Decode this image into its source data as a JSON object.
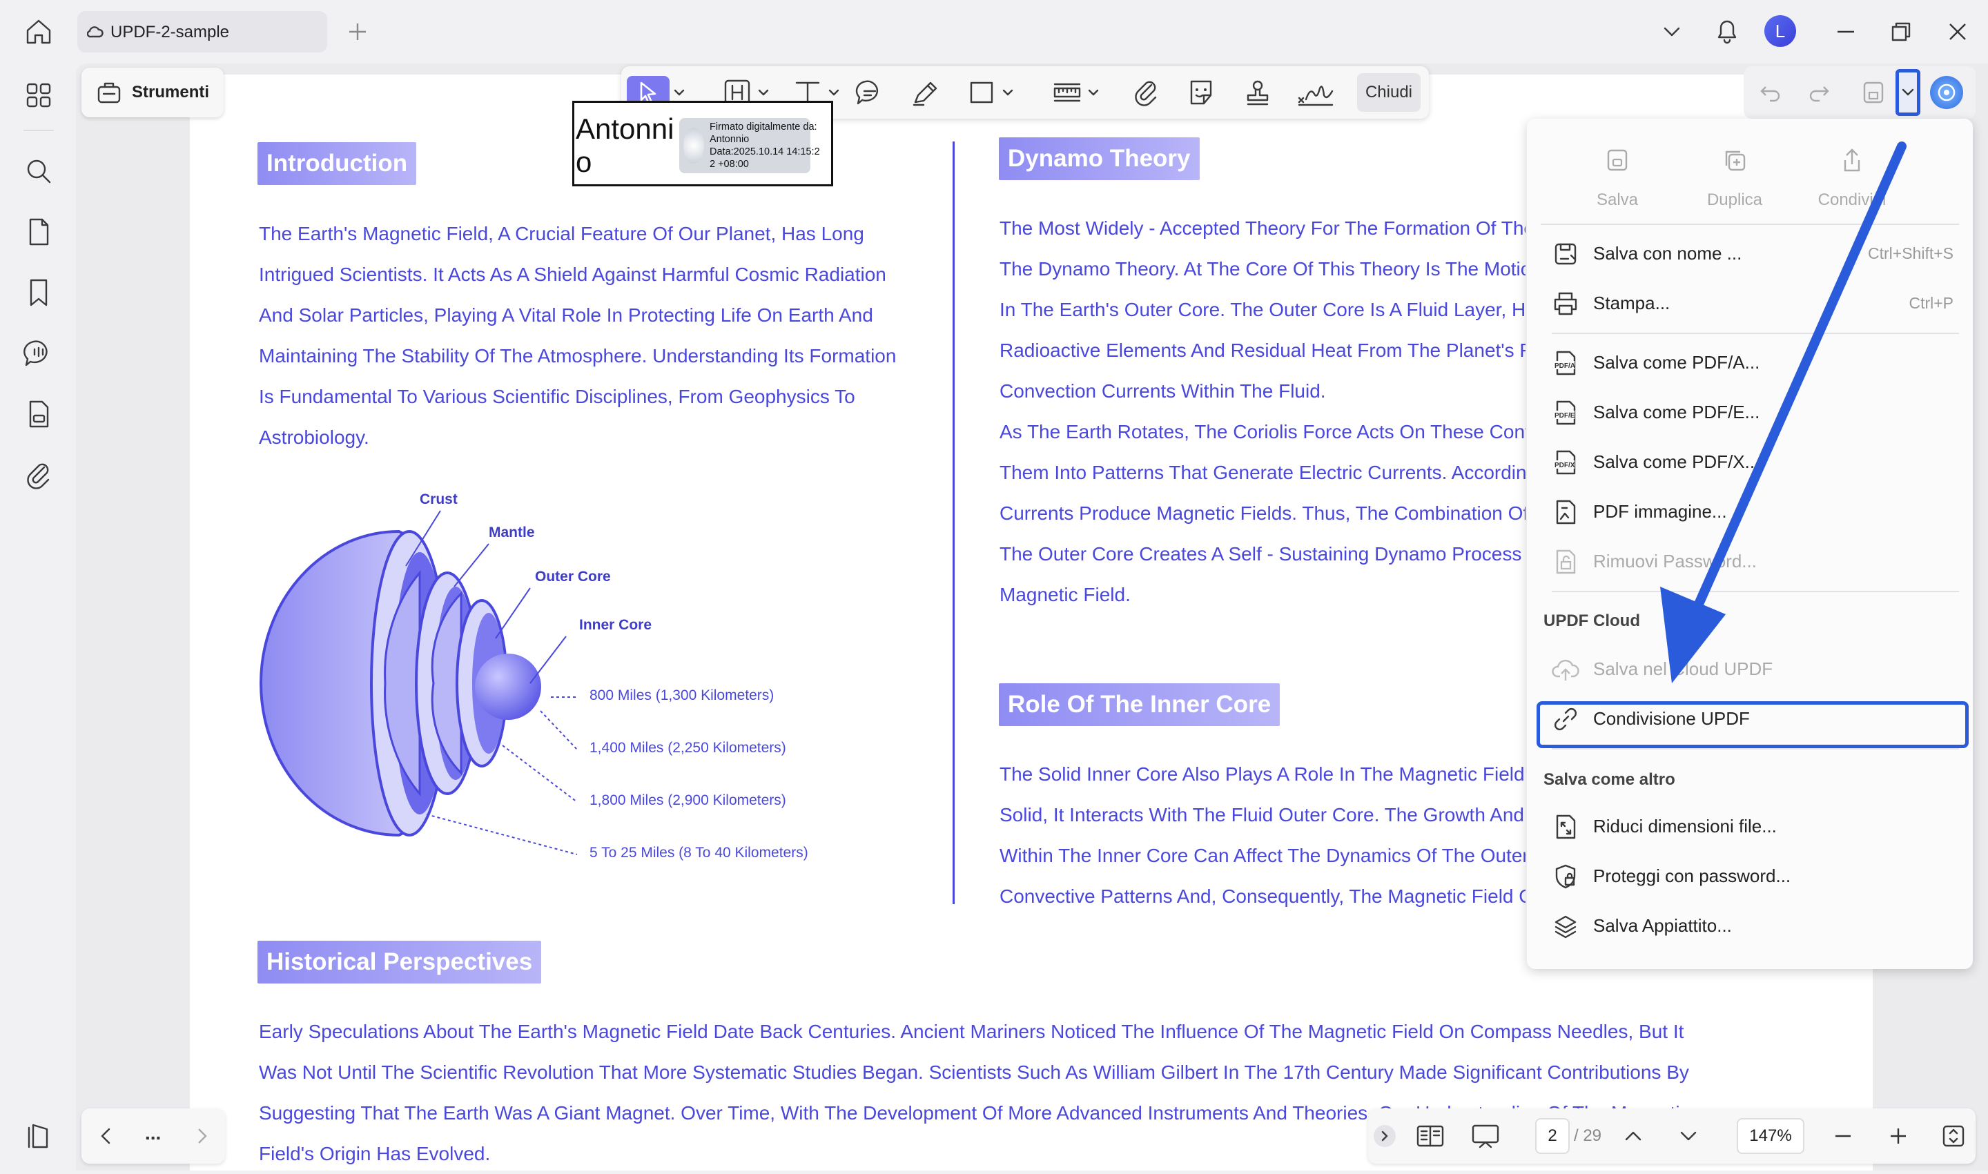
{
  "titlebar": {
    "tab_title": "UPDF-2-sample",
    "avatar_letter": "L",
    "accent": "#4a48dc"
  },
  "tools": {
    "strumenti_label": "Strumenti",
    "close_label": "Chiudi"
  },
  "signature": {
    "name": "Antonnio",
    "stamp_text": "Firmato digitalmente da:\nAntonnio\nData:2025.10.14 14:15:2\n2 +08:00"
  },
  "document": {
    "intro_heading": "Introduction",
    "intro_lines": [
      "The Earth's Magnetic Field, A Crucial Feature Of Our Planet, Has Long",
      "Intrigued Scientists. It Acts As A Shield Against Harmful Cosmic Radiation",
      "And Solar Particles, Playing A Vital Role In Protecting Life On Earth And",
      "Maintaining The Stability Of The Atmosphere. Understanding Its Formation",
      "Is Fundamental To Various Scientific Disciplines, From Geophysics To",
      "Astrobiology."
    ],
    "diagram_labels": {
      "crust": "Crust",
      "mantle": "Mantle",
      "outer_core": "Outer Core",
      "inner_core": "Inner Core",
      "d1": "800 Miles (1,300 Kilometers)",
      "d2": "1,400 Miles (2,250 Kilometers)",
      "d3": "1,800 Miles (2,900 Kilometers)",
      "d4": "5 To 25 Miles (8 To 40 Kilometers)"
    },
    "dynamo_heading": "Dynamo Theory",
    "dynamo_lines": [
      "The Most Widely - Accepted Theory For The Formation Of The",
      "The Dynamo Theory. At The Core Of This Theory Is The Motio",
      "In The Earth's Outer Core. The Outer Core Is A Fluid Layer, He",
      "Radioactive Elements And Residual Heat From The Planet's F",
      "Convection Currents Within The Fluid.",
      "As The Earth Rotates, The Coriolis Force Acts On These Conv",
      "Them Into Patterns That Generate Electric Currents. According",
      "Currents Produce Magnetic Fields. Thus, The Combination Of",
      "The Outer Core Creates A Self - Sustaining Dynamo Process T",
      "Magnetic Field."
    ],
    "inner_core_heading": "Role Of The Inner Core",
    "inner_core_lines": [
      "The Solid Inner Core Also Plays A Role In The Magnetic Field's",
      "Solid, It Interacts With The Fluid Outer Core. The Growth And C",
      "Within The Inner Core Can Affect The Dynamics Of The Outer",
      "Convective Patterns And, Consequently, The Magnetic Field G"
    ],
    "historical_heading": "Historical Perspectives",
    "historical_lines": [
      "Early Speculations About The Earth's Magnetic Field Date Back Centuries. Ancient Mariners Noticed The Influence Of The Magnetic Field On Compass Needles, But It",
      "Was Not Until The Scientific Revolution That More Systematic Studies Began. Scientists Such As William Gilbert In The 17th Century Made Significant Contributions By",
      "Suggesting That The Earth Was A Giant Magnet. Over Time, With The Development Of More Advanced Instruments And Theories, Our Understanding Of The Magnetic",
      "Field's Origin Has Evolved."
    ]
  },
  "menu": {
    "quick_actions": [
      "Salva",
      "Duplica",
      "Condividi"
    ],
    "items": [
      {
        "label": "Salva con nome ...",
        "shortcut": "Ctrl+Shift+S"
      },
      {
        "label": "Stampa...",
        "shortcut": "Ctrl+P"
      },
      {
        "label": "Salva come PDF/A..."
      },
      {
        "label": "Salva come PDF/E..."
      },
      {
        "label": "Salva come PDF/X..."
      },
      {
        "label": "PDF immagine..."
      },
      {
        "label": "Rimuovi Password..."
      }
    ],
    "cloud_section": "UPDF Cloud",
    "cloud_items": [
      {
        "label": "Salva nel Cloud UPDF"
      },
      {
        "label": "Condivisione UPDF"
      }
    ],
    "other_section": "Salva come altro",
    "other_items": [
      {
        "label": "Riduci dimensioni file..."
      },
      {
        "label": "Proteggi con password..."
      },
      {
        "label": "Salva Appiattito..."
      }
    ],
    "icon_texts": {
      "pdfa": "PDF/A",
      "pdfe": "PDF/E",
      "pdfx": "PDF/X"
    }
  },
  "bottom": {
    "more": "...",
    "page_current": "2",
    "page_total": "/ 29",
    "zoom": "147%"
  }
}
